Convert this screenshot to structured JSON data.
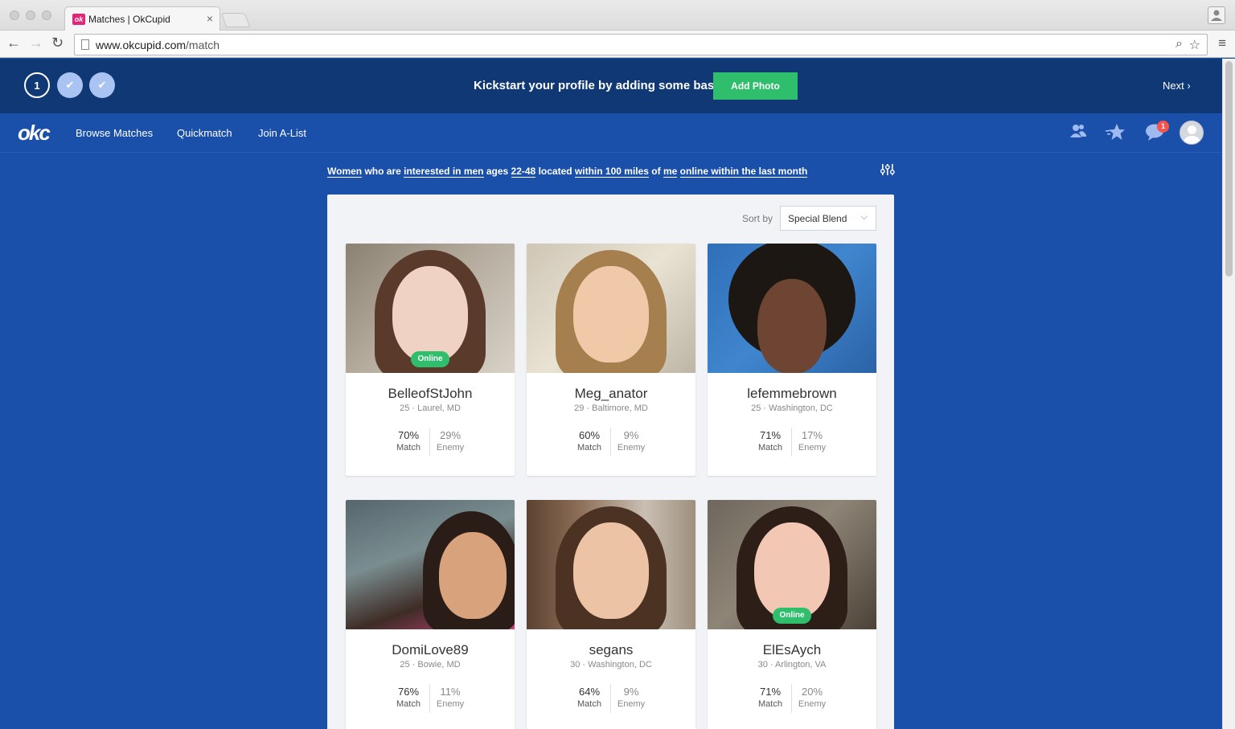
{
  "browser": {
    "tab_title": "Matches | OkCupid",
    "tab_favicon": "ok",
    "tab_close": "×",
    "url_host": "www.okcupid.com",
    "url_path": "/match"
  },
  "onboarding": {
    "step1": "1",
    "step2": "✔",
    "step3": "✔",
    "message": "Kickstart your profile by adding some basics.",
    "add_photo": "Add Photo",
    "next": "Next ›"
  },
  "nav": {
    "logo": "okc",
    "links": [
      "Browse Matches",
      "Quickmatch",
      "Join A-List"
    ],
    "message_badge": "1",
    "icons": [
      "people-icon",
      "star-icon",
      "chat-bubble-icon",
      "avatar"
    ]
  },
  "filter": {
    "w1": "Women",
    "w2": " who are ",
    "w3": "interested in men",
    "w4": " ages ",
    "w5": "22-48",
    "w6": " located ",
    "w7": "within 100 miles",
    "w8": " of ",
    "w9": "me",
    "w10": " ",
    "w11": "online within the last month"
  },
  "sort": {
    "label": "Sort by",
    "value": "Special Blend"
  },
  "colors": {
    "brand_blue": "#1a4faa",
    "header_navy": "#0f3875",
    "green": "#2fbe6b",
    "badge_red": "#f5534b"
  },
  "matches": [
    {
      "username": "BelleofStJohn",
      "meta": "25 · Laurel, MD",
      "match": "70%",
      "enemy": "29%",
      "online": "Online"
    },
    {
      "username": "Meg_anator",
      "meta": "29 · Baltimore, MD",
      "match": "60%",
      "enemy": "9%",
      "online": ""
    },
    {
      "username": "lefemmebrown",
      "meta": "25 · Washington, DC",
      "match": "71%",
      "enemy": "17%",
      "online": ""
    },
    {
      "username": "DomiLove89",
      "meta": "25 · Bowie, MD",
      "match": "76%",
      "enemy": "11%",
      "online": ""
    },
    {
      "username": "segans",
      "meta": "30 · Washington, DC",
      "match": "64%",
      "enemy": "9%",
      "online": ""
    },
    {
      "username": "ElEsAych",
      "meta": "30 · Arlington, VA",
      "match": "71%",
      "enemy": "20%",
      "online": "Online"
    }
  ],
  "labels": {
    "match": "Match",
    "enemy": "Enemy"
  }
}
